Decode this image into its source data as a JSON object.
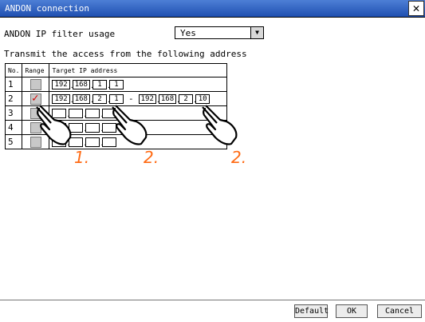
{
  "window": {
    "title": "ANDON connection",
    "close_glyph": "✕"
  },
  "filter": {
    "label": "ANDON IP filter usage",
    "selected": "Yes"
  },
  "transmit_label": "Transmit the access from the following address",
  "table": {
    "headers": {
      "no": "No.",
      "range": "Range",
      "target": "Target IP address"
    },
    "rows": [
      {
        "no": "1",
        "range": false,
        "from": [
          "192",
          "168",
          "1",
          "1"
        ],
        "to": []
      },
      {
        "no": "2",
        "range": true,
        "from": [
          "192",
          "168",
          "2",
          "1"
        ],
        "to": [
          "192",
          "168",
          "2",
          "10"
        ]
      },
      {
        "no": "3",
        "range": false,
        "from": [
          "",
          "",
          "",
          ""
        ],
        "to": []
      },
      {
        "no": "4",
        "range": false,
        "from": [
          "",
          "",
          "",
          ""
        ],
        "to": []
      },
      {
        "no": "5",
        "range": false,
        "from": [
          "",
          "",
          "",
          ""
        ],
        "to": []
      }
    ]
  },
  "steps": {
    "one": "1.",
    "two_a": "2.",
    "two_b": "2."
  },
  "buttons": {
    "default": "Default",
    "ok": "OK",
    "cancel": "Cancel"
  },
  "colors": {
    "titlebar": "#2d5ec3",
    "step_accent": "#ff6a13",
    "check": "#d40000"
  }
}
